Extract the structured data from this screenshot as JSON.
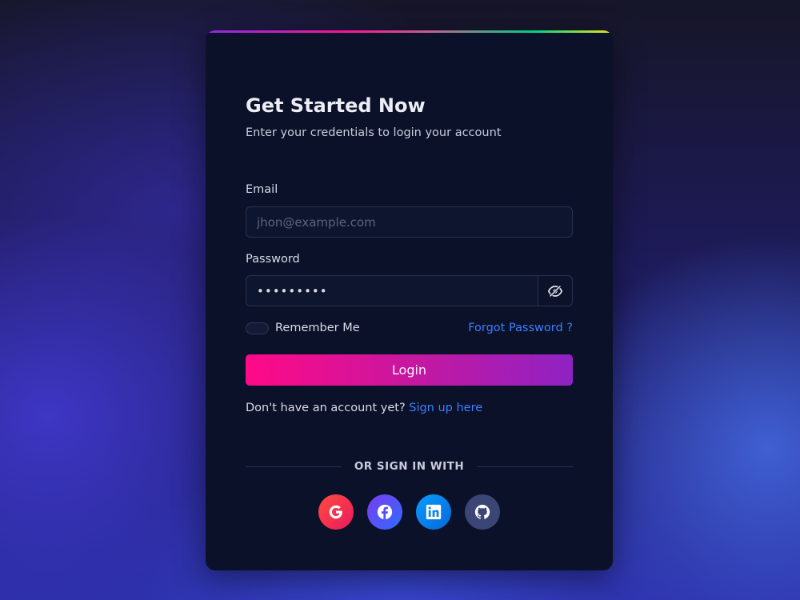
{
  "header": {
    "title": "Get Started Now",
    "subtitle": "Enter your credentials to login your account"
  },
  "email": {
    "label": "Email",
    "placeholder": "jhon@example.com",
    "value": ""
  },
  "password": {
    "label": "Password",
    "value": "•••••••••"
  },
  "options": {
    "remember_label": "Remember Me",
    "remember_checked": false,
    "forgot_label": "Forgot Password ?"
  },
  "login": {
    "label": "Login"
  },
  "signup": {
    "prompt": "Don't have an account yet?",
    "link": "Sign up here"
  },
  "divider": {
    "text": "OR SIGN IN WITH"
  },
  "socials": [
    {
      "icon": "google-icon",
      "color": "#f4433c"
    },
    {
      "icon": "facebook-icon",
      "color": "#5a4cf5"
    },
    {
      "icon": "linkedin-icon",
      "color": "#0a8af0"
    },
    {
      "icon": "github-icon",
      "color": "#3b4677"
    }
  ],
  "colors": {
    "card_bg": "#0b1128",
    "link": "#3d7eff",
    "button_start": "#ff0a87",
    "button_end": "#8f22c3"
  }
}
